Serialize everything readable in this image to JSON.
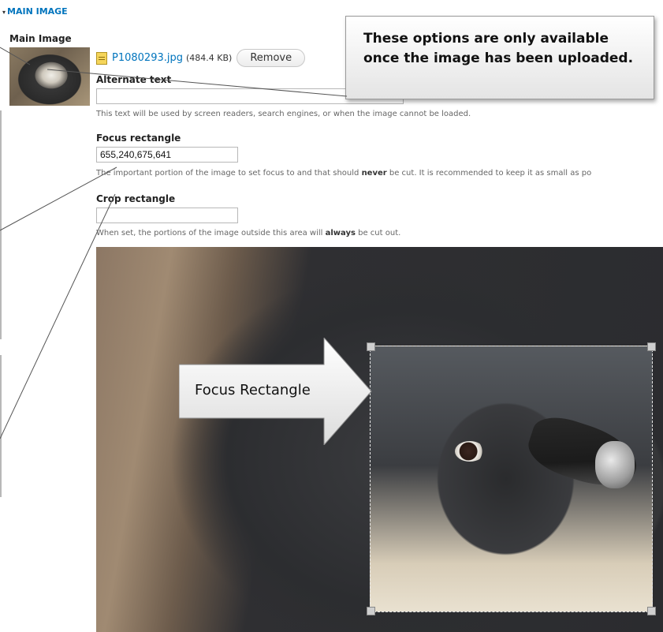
{
  "section": {
    "arrow": "▾",
    "title": "MAIN IMAGE"
  },
  "main_image_label": "Main Image",
  "file": {
    "name": "P1080293.jpg",
    "size": "(484.4 KB)",
    "remove_label": "Remove",
    "icon": "image-file-icon"
  },
  "alternate_text": {
    "label": "Alternate text",
    "value": "",
    "description": "This text will be used by screen readers, search engines, or when the image cannot be loaded."
  },
  "focus_rectangle": {
    "label": "Focus rectangle",
    "value": "655,240,675,641",
    "description_pre": "The important portion of the image to set focus to and that should ",
    "description_em": "never",
    "description_post": " be cut. It is recommended to keep it as small as po"
  },
  "crop_rectangle": {
    "label": "Crop rectangle",
    "value": "",
    "description_pre": "When set, the portions of the image outside this area will ",
    "description_em": "always",
    "description_post": " be cut out."
  },
  "annotations": {
    "callout_text": "These options are only available once the image has been uploaded.",
    "arrow_label": "Focus Rectangle"
  },
  "colors": {
    "link": "#0074bd",
    "callout_border": "#9a9a9a"
  }
}
